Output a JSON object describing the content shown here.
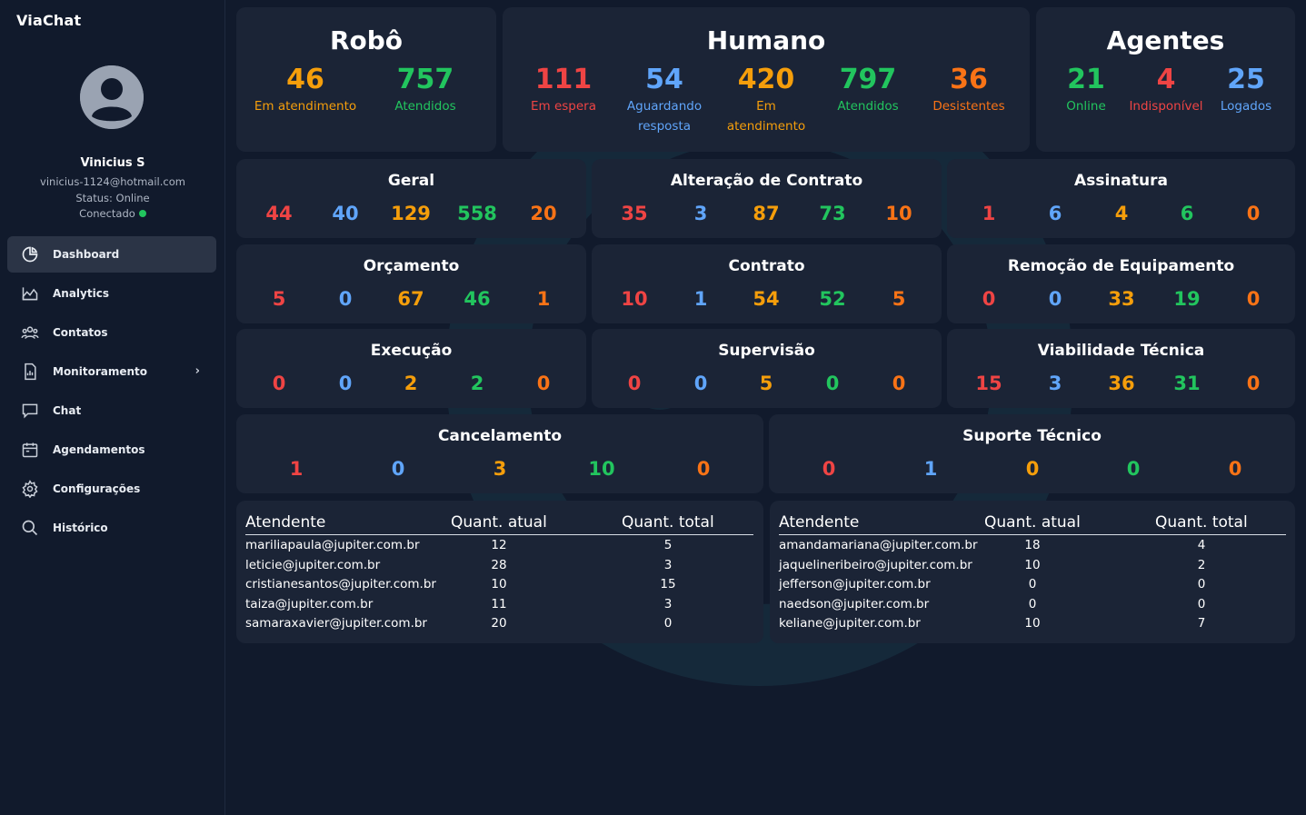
{
  "sidebar": {
    "brand": "ViaChat",
    "user": {
      "name": "Vinicius S",
      "email": "vinicius-1124@hotmail.com",
      "status": "Status: Online",
      "connection": "Conectado"
    },
    "items": [
      {
        "label": "Dashboard",
        "icon": "pie-chart-icon"
      },
      {
        "label": "Analytics",
        "icon": "area-chart-icon"
      },
      {
        "label": "Contatos",
        "icon": "users-icon"
      },
      {
        "label": "Monitoramento",
        "icon": "report-icon"
      },
      {
        "label": "Chat",
        "icon": "chat-bubble-icon"
      },
      {
        "label": "Agendamentos",
        "icon": "calendar-icon"
      },
      {
        "label": "Configurações",
        "icon": "gear-icon"
      },
      {
        "label": "Histórico",
        "icon": "search-icon"
      }
    ],
    "chevron": "›"
  },
  "top": {
    "robo": {
      "title": "Robô",
      "stats": [
        {
          "value": "46",
          "label": "Em atendimento"
        },
        {
          "value": "757",
          "label": "Atendidos"
        }
      ]
    },
    "humano": {
      "title": "Humano",
      "stats": [
        {
          "value": "111",
          "label": "Em espera"
        },
        {
          "value": "54",
          "label": "Aguardando resposta"
        },
        {
          "value": "420",
          "label": "Em atendimento"
        },
        {
          "value": "797",
          "label": "Atendidos"
        },
        {
          "value": "36",
          "label": "Desistentes"
        }
      ]
    },
    "agentes": {
      "title": "Agentes",
      "stats": [
        {
          "value": "21",
          "label": "Online"
        },
        {
          "value": "4",
          "label": "Indisponível"
        },
        {
          "value": "25",
          "label": "Logados"
        }
      ]
    }
  },
  "queues": [
    {
      "title": "Geral",
      "values": [
        "44",
        "40",
        "129",
        "558",
        "20"
      ]
    },
    {
      "title": "Alteração de Contrato",
      "values": [
        "35",
        "3",
        "87",
        "73",
        "10"
      ]
    },
    {
      "title": "Assinatura",
      "values": [
        "1",
        "6",
        "4",
        "6",
        "0"
      ]
    },
    {
      "title": "Orçamento",
      "values": [
        "5",
        "0",
        "67",
        "46",
        "1"
      ]
    },
    {
      "title": "Contrato",
      "values": [
        "10",
        "1",
        "54",
        "52",
        "5"
      ]
    },
    {
      "title": "Remoção de Equipamento",
      "values": [
        "0",
        "0",
        "33",
        "19",
        "0"
      ]
    },
    {
      "title": "Execução",
      "values": [
        "0",
        "0",
        "2",
        "2",
        "0"
      ]
    },
    {
      "title": "Supervisão",
      "values": [
        "0",
        "0",
        "5",
        "0",
        "0"
      ]
    },
    {
      "title": "Viabilidade Técnica",
      "values": [
        "15",
        "3",
        "36",
        "31",
        "0"
      ]
    },
    {
      "title": "Cancelamento",
      "values": [
        "1",
        "0",
        "3",
        "10",
        "0"
      ]
    },
    {
      "title": "Suporte Técnico",
      "values": [
        "0",
        "1",
        "0",
        "0",
        "0"
      ]
    }
  ],
  "tables": [
    {
      "headers": [
        "Atendente",
        "Quant. atual",
        "Quant. total"
      ],
      "rows": [
        [
          "mariliapaula@jupiter.com.br",
          "12",
          "5"
        ],
        [
          "leticie@jupiter.com.br",
          "28",
          "3"
        ],
        [
          "cristianesantos@jupiter.com.br",
          "10",
          "15"
        ],
        [
          "taiza@jupiter.com.br",
          "11",
          "3"
        ],
        [
          "samaraxavier@jupiter.com.br",
          "20",
          "0"
        ]
      ]
    },
    {
      "headers": [
        "Atendente",
        "Quant. atual",
        "Quant. total"
      ],
      "rows": [
        [
          "amandamariana@jupiter.com.br",
          "18",
          "4"
        ],
        [
          "jaquelineribeiro@jupiter.com.br",
          "10",
          "2"
        ],
        [
          "jefferson@jupiter.com.br",
          "0",
          "0"
        ],
        [
          "naedson@jupiter.com.br",
          "0",
          "0"
        ],
        [
          "keliane@jupiter.com.br",
          "10",
          "7"
        ]
      ]
    }
  ],
  "colors": {
    "background": "#111a2c",
    "card": "#1b2436",
    "red": "#ef4444",
    "blue": "#60a5fa",
    "orange": "#f59e0b",
    "green": "#22c55e",
    "dark_orange": "#f97316"
  }
}
